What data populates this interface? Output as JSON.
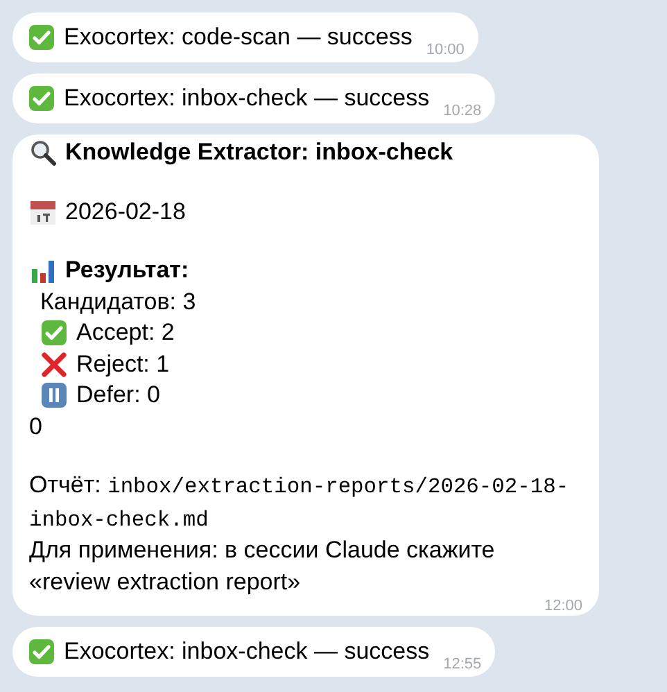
{
  "messages": [
    {
      "kind": "status",
      "text": "Exocortex: code-scan — success",
      "time": "10:00"
    },
    {
      "kind": "status",
      "text": "Exocortex: inbox-check — success",
      "time": "10:28"
    },
    {
      "kind": "report",
      "time": "12:00",
      "paragraphs": [
        [
          {
            "kind": "search_title",
            "text": "Knowledge Extractor: inbox-check"
          }
        ],
        [
          {
            "kind": "date",
            "text": "2026-02-18"
          }
        ],
        [
          {
            "kind": "result_title",
            "text": "Результат:"
          },
          {
            "kind": "count",
            "text": "Кандидатов: 3"
          },
          {
            "kind": "accept",
            "text": "Accept: 2"
          },
          {
            "kind": "reject",
            "text": "Reject: 1"
          },
          {
            "kind": "defer",
            "text": "Defer: 0"
          },
          {
            "kind": "plain",
            "text": "0"
          }
        ],
        [
          {
            "kind": "path",
            "label": "Отчёт:",
            "path": "inbox/extraction-reports/2026-02-18-inbox-check.md"
          },
          {
            "kind": "plain",
            "text": "Для применения: в сессии Claude скажите «review extraction report»"
          }
        ]
      ]
    },
    {
      "kind": "status",
      "text": "Exocortex: inbox-check — success",
      "time": "12:55"
    }
  ]
}
